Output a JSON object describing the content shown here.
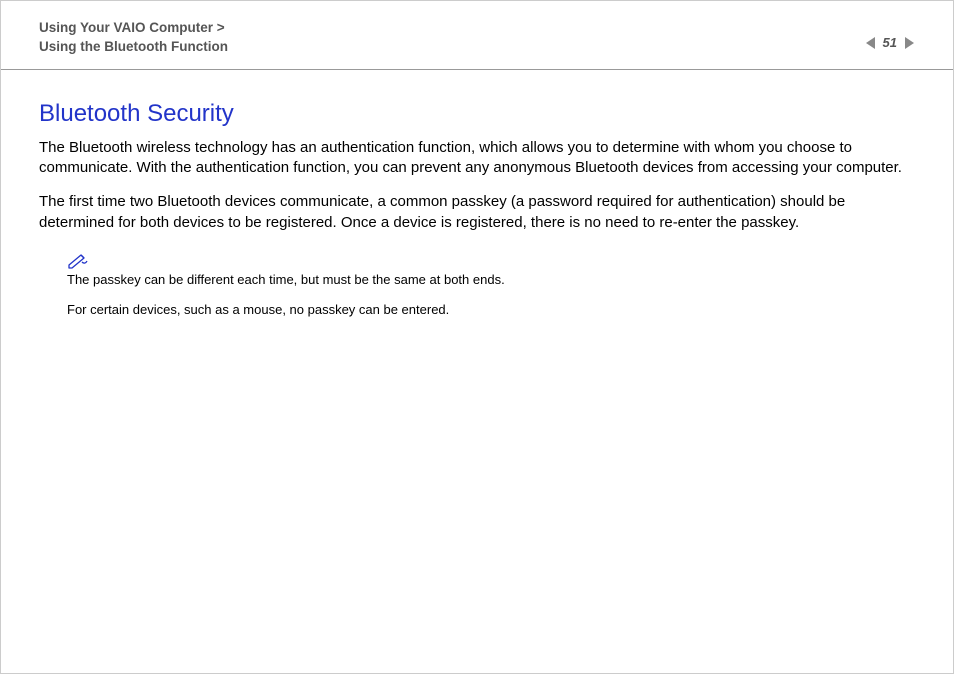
{
  "header": {
    "breadcrumb_line1": "Using Your VAIO Computer >",
    "breadcrumb_line2": "Using the Bluetooth Function",
    "page_number": "51"
  },
  "content": {
    "title": "Bluetooth Security",
    "para1": "The Bluetooth wireless technology has an authentication function, which allows you to determine with whom you choose to communicate. With the authentication function, you can prevent any anonymous Bluetooth devices from accessing your computer.",
    "para2": "The first time two Bluetooth devices communicate, a common passkey (a password required for authentication) should be determined for both devices to be registered. Once a device is registered, there is no need to re-enter the passkey.",
    "note1": "The passkey can be different each time, but must be the same at both ends.",
    "note2": "For certain devices, such as a mouse, no passkey can be entered."
  }
}
